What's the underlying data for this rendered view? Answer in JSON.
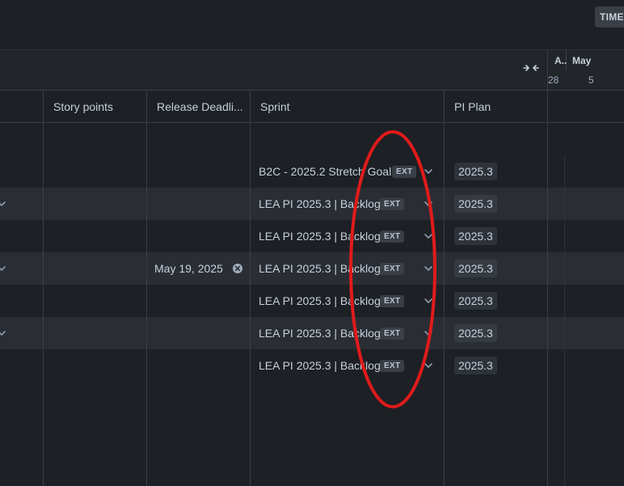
{
  "toolbar": {
    "timeline_label": "TIME"
  },
  "timeline": {
    "months": [
      {
        "label": "A.."
      },
      {
        "label": "May"
      }
    ],
    "days": [
      {
        "label": "28"
      },
      {
        "label": "5"
      }
    ]
  },
  "columns": [
    {
      "label": "Story points"
    },
    {
      "label": "Release Deadli..."
    },
    {
      "label": "Sprint"
    },
    {
      "label": "PI Plan"
    }
  ],
  "rows": [
    {
      "sprint": "B2C - 2025.2 Stretch Goal",
      "badge": "EXT",
      "pi_plan": "2025.3",
      "release_deadline": "",
      "alt": false
    },
    {
      "sprint": "LEA PI 2025.3 | Backlog",
      "badge": "EXT",
      "pi_plan": "2025.3",
      "release_deadline": "",
      "alt": true
    },
    {
      "sprint": "LEA PI 2025.3 | Backlog",
      "badge": "EXT",
      "pi_plan": "2025.3",
      "release_deadline": "",
      "alt": false
    },
    {
      "sprint": "LEA PI 2025.3 | Backlog",
      "badge": "EXT",
      "pi_plan": "2025.3",
      "release_deadline": "May 19, 2025",
      "alt": true
    },
    {
      "sprint": "LEA PI 2025.3 | Backlog",
      "badge": "EXT",
      "pi_plan": "2025.3",
      "release_deadline": "",
      "alt": false
    },
    {
      "sprint": "LEA PI 2025.3 | Backlog",
      "badge": "EXT",
      "pi_plan": "2025.3",
      "release_deadline": "",
      "alt": true
    },
    {
      "sprint": "LEA PI 2025.3 | Backlog",
      "badge": "EXT",
      "pi_plan": "2025.3",
      "release_deadline": "",
      "alt": false
    }
  ],
  "icons": {
    "collapse": "collapse-arrows-icon",
    "dropdown": "chevron-down-icon",
    "clear": "clear-circle-icon"
  },
  "colors": {
    "background": "#1d2025",
    "row_alt": "#2a2e34",
    "annotation": "#e01b1b"
  }
}
